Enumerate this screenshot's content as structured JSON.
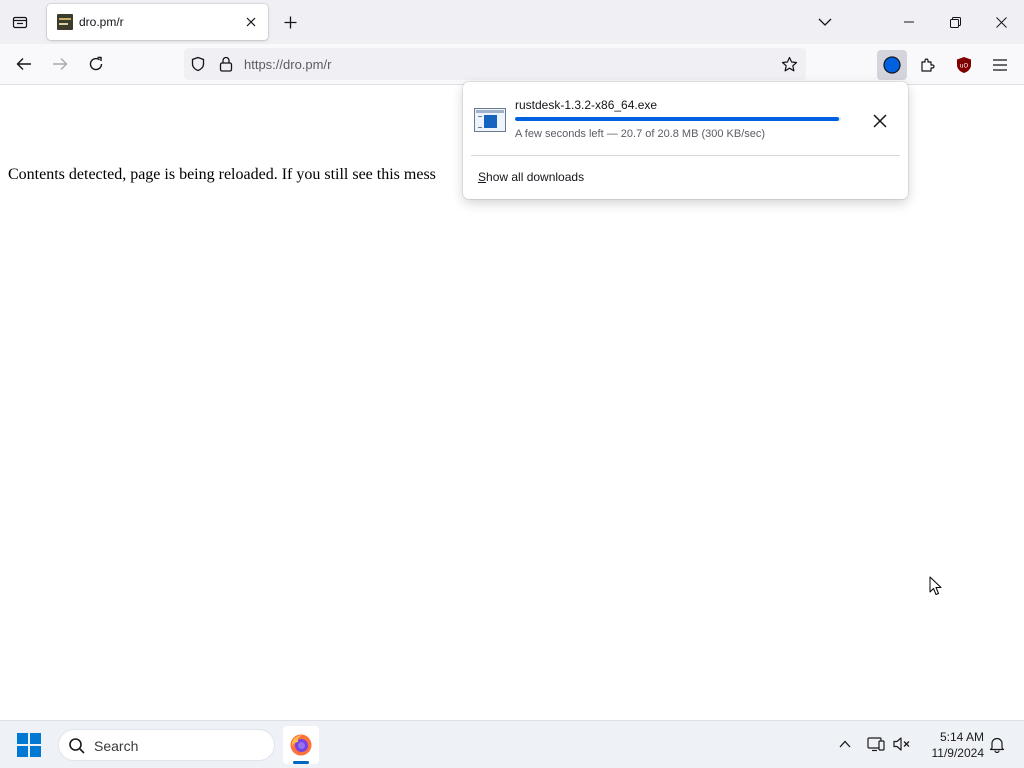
{
  "tab": {
    "title": "dro.pm/r"
  },
  "address_bar": {
    "url": "https://dro.pm/r"
  },
  "page": {
    "message": "Contents detected, page is being reloaded. If you still see this mess"
  },
  "downloads_panel": {
    "filename": "rustdesk-1.3.2-x86_64.exe",
    "status": "A few seconds left — 20.7 of 20.8 MB (300 KB/sec)",
    "progress_percent": 99.5,
    "show_all_prefix": "S",
    "show_all_rest": "how all downloads"
  },
  "taskbar": {
    "search_placeholder": "Search",
    "time": "5:14 AM",
    "date": "11/9/2024"
  },
  "colors": {
    "accent": "#0061e0",
    "ublock": "#800000"
  },
  "icons": [
    "tab-list-icon",
    "close-icon",
    "plus-icon",
    "chevron-down-icon",
    "minimize-icon",
    "restore-icon",
    "back-arrow-icon",
    "forward-arrow-icon",
    "reload-icon",
    "shield-icon",
    "lock-icon",
    "star-icon",
    "downloads-icon",
    "extensions-icon",
    "ublock-icon",
    "menu-icon",
    "windows-logo-icon",
    "search-icon",
    "firefox-icon",
    "chevron-up-icon",
    "network-icon",
    "speaker-muted-icon",
    "bell-icon"
  ]
}
